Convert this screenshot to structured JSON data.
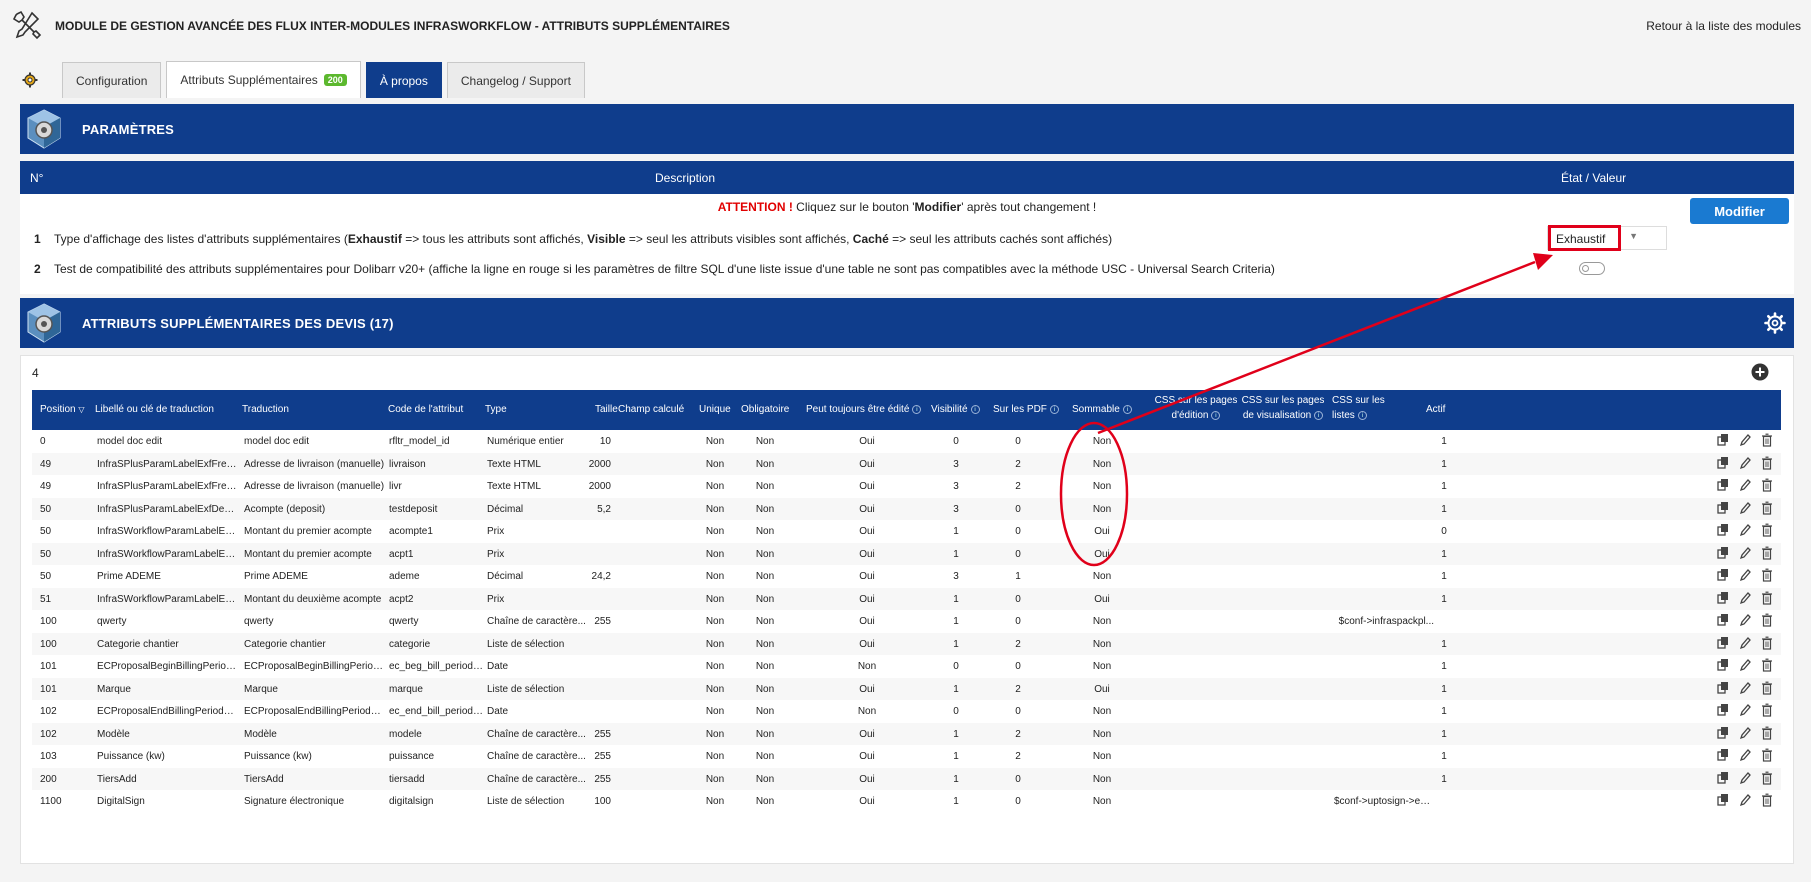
{
  "header": {
    "title": "MODULE DE GESTION AVANCÉE DES FLUX INTER-MODULES INFRASWORKFLOW - ATTRIBUTS SUPPLÉMENTAIRES",
    "back_link": "Retour à la liste des modules"
  },
  "tabs": [
    {
      "label": "Configuration"
    },
    {
      "label": "Attributs Supplémentaires",
      "badge": "200"
    },
    {
      "label": "À propos"
    },
    {
      "label": "Changelog / Support"
    }
  ],
  "params": {
    "title": "PARAMÈTRES",
    "headers": {
      "num": "N°",
      "description": "Description",
      "state": "État / Valeur"
    },
    "attention_prefix": "ATTENTION !",
    "attention_a": " Cliquez sur le bouton '",
    "attention_b": "Modifier",
    "attention_c": "' après tout changement !",
    "modify_button": "Modifier",
    "row1": {
      "num": "1",
      "t1": "Type d'affichage des listes d'attributs supplémentaires (",
      "b1": "Exhaustif",
      "t2": " => tous les attributs sont affichés, ",
      "b2": "Visible",
      "t3": " => seul les attributs visibles sont affichés, ",
      "b3": "Caché",
      "t4": " => seul les attributs cachés sont affichés)",
      "value": "Exhaustif"
    },
    "row2": {
      "num": "2",
      "text": "Test de compatibilité des attributs supplémentaires pour Dolibarr v20+ (affiche la ligne en rouge si les paramètres de filtre SQL d'une liste issue d'une table ne sont pas compatibles avec la méthode USC - Universal Search Criteria)"
    }
  },
  "attrs": {
    "title": "ATTRIBUTS SUPPLÉMENTAIRES DES DEVIS (17)",
    "count": "4",
    "columns": {
      "position": "Position",
      "label": "Libellé ou clé de traduction",
      "translation": "Traduction",
      "code": "Code de l'attribut",
      "type": "Type",
      "size": "Taille",
      "computed": "Champ calculé",
      "unique": "Unique",
      "required": "Obligatoire",
      "always_editable": "Peut toujours être édité",
      "visibility": "Visibilité",
      "pdf": "Sur les PDF",
      "summable": "Sommable",
      "css_edit_1": "CSS sur les pages",
      "css_edit_2": "d'édition",
      "css_view_1": "CSS sur les pages",
      "css_view_2": "de visualisation",
      "css_list_1": "CSS sur les",
      "css_list_2": "listes",
      "active": "Actif"
    },
    "rows": [
      {
        "position": "0",
        "label": "model doc edit",
        "translation": "model doc edit",
        "code": "rfltr_model_id",
        "type": "Numérique entier",
        "size": "10",
        "unique": "Non",
        "required": "Non",
        "always_editable": "Oui",
        "visibility": "0",
        "pdf": "0",
        "summable": "Non",
        "css_list": "",
        "active": "1"
      },
      {
        "position": "49",
        "label": "InfraSPlusParamLabelExfFreeAd...",
        "translation": "Adresse de livraison (manuelle)",
        "code": "livraison",
        "type": "Texte HTML",
        "size": "2000",
        "unique": "Non",
        "required": "Non",
        "always_editable": "Oui",
        "visibility": "3",
        "pdf": "2",
        "summable": "Non",
        "css_list": "",
        "active": "1"
      },
      {
        "position": "49",
        "label": "InfraSPlusParamLabelExfFreeAd...",
        "translation": "Adresse de livraison (manuelle)",
        "code": "livr",
        "type": "Texte HTML",
        "size": "2000",
        "unique": "Non",
        "required": "Non",
        "always_editable": "Oui",
        "visibility": "3",
        "pdf": "2",
        "summable": "Non",
        "css_list": "",
        "active": "1"
      },
      {
        "position": "50",
        "label": "InfraSPlusParamLabelExfDeposit",
        "translation": "Acompte (deposit)",
        "code": "testdeposit",
        "type": "Décimal",
        "size": "5,2",
        "unique": "Non",
        "required": "Non",
        "always_editable": "Oui",
        "visibility": "3",
        "pdf": "0",
        "summable": "Non",
        "css_list": "",
        "active": "1"
      },
      {
        "position": "50",
        "label": "InfraSWorkflowParamLabelExfDe...",
        "translation": "Montant du premier acompte",
        "code": "acompte1",
        "type": "Prix",
        "size": "",
        "unique": "Non",
        "required": "Non",
        "always_editable": "Oui",
        "visibility": "1",
        "pdf": "0",
        "summable": "Oui",
        "css_list": "",
        "active": "0"
      },
      {
        "position": "50",
        "label": "InfraSWorkflowParamLabelExfDe...",
        "translation": "Montant du premier acompte",
        "code": "acpt1",
        "type": "Prix",
        "size": "",
        "unique": "Non",
        "required": "Non",
        "always_editable": "Oui",
        "visibility": "1",
        "pdf": "0",
        "summable": "Oui",
        "css_list": "",
        "active": "1"
      },
      {
        "position": "50",
        "label": "Prime ADEME",
        "translation": "Prime ADEME",
        "code": "ademe",
        "type": "Décimal",
        "size": "24,2",
        "unique": "Non",
        "required": "Non",
        "always_editable": "Oui",
        "visibility": "3",
        "pdf": "1",
        "summable": "Non",
        "css_list": "",
        "active": "1"
      },
      {
        "position": "51",
        "label": "InfraSWorkflowParamLabelExfSe...",
        "translation": "Montant du deuxième acompte",
        "code": "acpt2",
        "type": "Prix",
        "size": "",
        "unique": "Non",
        "required": "Non",
        "always_editable": "Oui",
        "visibility": "1",
        "pdf": "0",
        "summable": "Oui",
        "css_list": "",
        "active": "1"
      },
      {
        "position": "100",
        "label": "qwerty",
        "translation": "qwerty",
        "code": "qwerty",
        "type": "Chaîne de caractère...",
        "size": "255",
        "unique": "Non",
        "required": "Non",
        "always_editable": "Oui",
        "visibility": "1",
        "pdf": "0",
        "summable": "Non",
        "css_list": "$conf->infraspackpl...",
        "active": ""
      },
      {
        "position": "100",
        "label": "Categorie chantier",
        "translation": "Categorie chantier",
        "code": "categorie",
        "type": "Liste de sélection",
        "size": "",
        "unique": "Non",
        "required": "Non",
        "always_editable": "Oui",
        "visibility": "1",
        "pdf": "2",
        "summable": "Non",
        "css_list": "",
        "active": "1"
      },
      {
        "position": "101",
        "label": "ECProposalBeginBillingPeriodDate",
        "translation": "ECProposalBeginBillingPeriodDate",
        "code": "ec_beg_bill_period_...",
        "type": "Date",
        "size": "",
        "unique": "Non",
        "required": "Non",
        "always_editable": "Non",
        "visibility": "0",
        "pdf": "0",
        "summable": "Non",
        "css_list": "",
        "active": "1"
      },
      {
        "position": "101",
        "label": "Marque",
        "translation": "Marque",
        "code": "marque",
        "type": "Liste de sélection",
        "size": "",
        "unique": "Non",
        "required": "Non",
        "always_editable": "Oui",
        "visibility": "1",
        "pdf": "2",
        "summable": "Oui",
        "css_list": "",
        "active": "1"
      },
      {
        "position": "102",
        "label": "ECProposalEndBillingPeriodDate",
        "translation": "ECProposalEndBillingPeriodDate",
        "code": "ec_end_bill_period_...",
        "type": "Date",
        "size": "",
        "unique": "Non",
        "required": "Non",
        "always_editable": "Non",
        "visibility": "0",
        "pdf": "0",
        "summable": "Non",
        "css_list": "",
        "active": "1"
      },
      {
        "position": "102",
        "label": "Modèle",
        "translation": "Modèle",
        "code": "modele",
        "type": "Chaîne de caractère...",
        "size": "255",
        "unique": "Non",
        "required": "Non",
        "always_editable": "Oui",
        "visibility": "1",
        "pdf": "2",
        "summable": "Non",
        "css_list": "",
        "active": "1"
      },
      {
        "position": "103",
        "label": "Puissance (kw)",
        "translation": "Puissance (kw)",
        "code": "puissance",
        "type": "Chaîne de caractère...",
        "size": "255",
        "unique": "Non",
        "required": "Non",
        "always_editable": "Oui",
        "visibility": "1",
        "pdf": "2",
        "summable": "Non",
        "css_list": "",
        "active": "1"
      },
      {
        "position": "200",
        "label": "TiersAdd",
        "translation": "TiersAdd",
        "code": "tiersadd",
        "type": "Chaîne de caractère...",
        "size": "255",
        "unique": "Non",
        "required": "Non",
        "always_editable": "Oui",
        "visibility": "1",
        "pdf": "0",
        "summable": "Non",
        "css_list": "",
        "active": "1"
      },
      {
        "position": "1100",
        "label": "DigitalSign",
        "translation": "Signature électronique",
        "code": "digitalsign",
        "type": "Liste de sélection",
        "size": "100",
        "unique": "Non",
        "required": "Non",
        "always_editable": "Oui",
        "visibility": "1",
        "pdf": "0",
        "summable": "Non",
        "css_list": "$conf->uptosign->en...",
        "active": ""
      }
    ]
  },
  "colors": {
    "primary": "#0f3d8c",
    "button": "#1a7ad1",
    "annotation": "#e0001a",
    "badge": "#5cb82e"
  }
}
